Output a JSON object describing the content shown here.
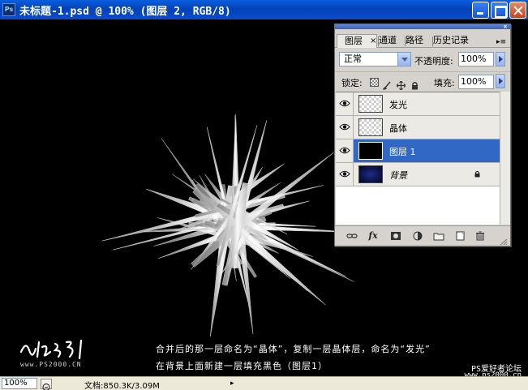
{
  "window": {
    "title": "未标题-1.psd @ 100% (图层 2, RGB/8)",
    "app_icon": "ps-icon",
    "app_icon_label": "Ps",
    "controls": [
      "minimize-icon",
      "maximize-icon",
      "close-icon"
    ]
  },
  "canvas": {
    "caption_line1": "合并后的那一层命名为“晶体”，复制一层晶体层，命名为“发光”",
    "caption_line2": "在背景上面新建一层填充黑色（图层1）",
    "watermark_url": "www.PS2000.CN",
    "corner_text1": "PS爱好者论坛",
    "corner_text2": "www.ps2000.cn"
  },
  "statusbar": {
    "zoom": "100%",
    "doc_info": "文档:850.3K/3.09M",
    "more": "▸"
  },
  "layers_panel": {
    "tabs": [
      {
        "label": "图层",
        "active": true,
        "close": "×"
      },
      {
        "label": "通道",
        "active": false
      },
      {
        "label": "路径",
        "active": false
      },
      {
        "label": "历史记录",
        "active": false
      }
    ],
    "menu": "▸≡",
    "blend_mode": "正常",
    "opacity_label": "不透明度:",
    "opacity": "100%",
    "lock_label": "锁定:",
    "fill_label": "填充:",
    "fill": "100%",
    "layers": [
      {
        "name": "发光",
        "thumb": "transparent",
        "visible": true,
        "selected": false
      },
      {
        "name": "晶体",
        "thumb": "transparent",
        "visible": true,
        "selected": false
      },
      {
        "name": "图层 1",
        "thumb": "black",
        "visible": true,
        "selected": true
      },
      {
        "name": "背景",
        "thumb": "navy",
        "visible": true,
        "selected": false,
        "locked": true
      }
    ],
    "bottom_icons": [
      "link-icon",
      "fx-icon",
      "mask-icon",
      "adjustment-icon",
      "folder-icon",
      "new-layer-icon",
      "trash-icon"
    ],
    "fx_label": "fx"
  },
  "colors": {
    "titlebar": "#0542b8",
    "selection": "#3168c6",
    "panel_bg": "#d6d3ce"
  }
}
